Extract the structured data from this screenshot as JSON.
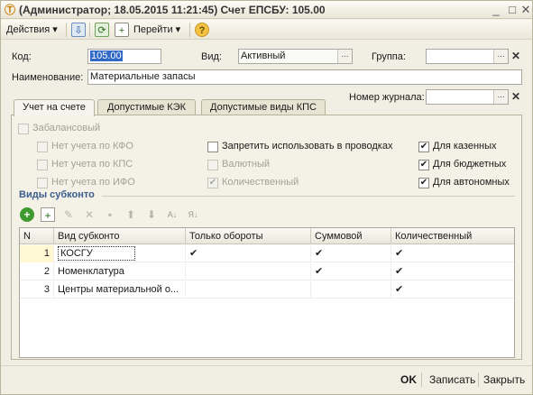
{
  "window": {
    "title": "(Администратор; 18.05.2015 11:21:45) Счет ЕПСБУ: 105.00",
    "icon": "1c-app-icon"
  },
  "toolbar": {
    "actions_label": "Действия",
    "goto_label": "Перейти",
    "icons": [
      "post-icon",
      "refresh-icon",
      "copy-doc-icon",
      "help-icon"
    ]
  },
  "form": {
    "code_label": "Код:",
    "code_value": "105.00",
    "kind_label": "Вид:",
    "kind_value": "Активный",
    "group_label": "Группа:",
    "group_value": "",
    "name_label": "Наименование:",
    "name_value": "Материальные запасы",
    "journal_label": "Номер журнала:",
    "journal_value": ""
  },
  "tabs": [
    {
      "label": "Учет на счете",
      "active": true
    },
    {
      "label": "Допустимые КЭК",
      "active": false
    },
    {
      "label": "Допустимые виды КПС",
      "active": false
    }
  ],
  "checkboxes": {
    "off_balance": {
      "label": "Забалансовый",
      "checked": false,
      "disabled": true
    },
    "no_kfo": {
      "label": "Нет учета по КФО",
      "checked": false,
      "disabled": true
    },
    "no_kps": {
      "label": "Нет учета по КПС",
      "checked": false,
      "disabled": true
    },
    "no_ifo": {
      "label": "Нет учета по ИФО",
      "checked": false,
      "disabled": true
    },
    "forbid": {
      "label": "Запретить использовать в проводках",
      "checked": false,
      "disabled": false
    },
    "currency": {
      "label": "Валютный",
      "checked": false,
      "disabled": true
    },
    "quantity": {
      "label": "Количественный",
      "checked": true,
      "disabled": true
    },
    "treasury": {
      "label": "Для казенных",
      "checked": true,
      "disabled": false
    },
    "budget": {
      "label": "Для бюджетных",
      "checked": true,
      "disabled": false
    },
    "autonomous": {
      "label": "Для автономных",
      "checked": true,
      "disabled": false
    }
  },
  "subconto": {
    "title": "Виды субконто",
    "toolbar_icons": [
      "add-icon",
      "add-copy-icon",
      "edit-icon",
      "delete-icon",
      "save-icon",
      "move-up-icon",
      "move-down-icon",
      "sort-asc-icon",
      "sort-desc-icon"
    ],
    "columns": [
      "N",
      "Вид субконто",
      "Только обороты",
      "Суммовой",
      "Количественный"
    ],
    "rows": [
      {
        "n": "1",
        "name": "КОСГУ",
        "turnover": "✔",
        "sum": "✔",
        "qty": "✔"
      },
      {
        "n": "2",
        "name": "Номенклатура",
        "turnover": "",
        "sum": "✔",
        "qty": "✔"
      },
      {
        "n": "3",
        "name": "Центры материальной о...",
        "turnover": "",
        "sum": "",
        "qty": "✔"
      }
    ]
  },
  "footer": {
    "ok_label": "OK",
    "save_label": "Записать",
    "close_label": "Закрыть"
  },
  "colors": {
    "window_bg": "#f1eee3",
    "selection": "#3169c6",
    "section_title": "#3b5d8f"
  }
}
